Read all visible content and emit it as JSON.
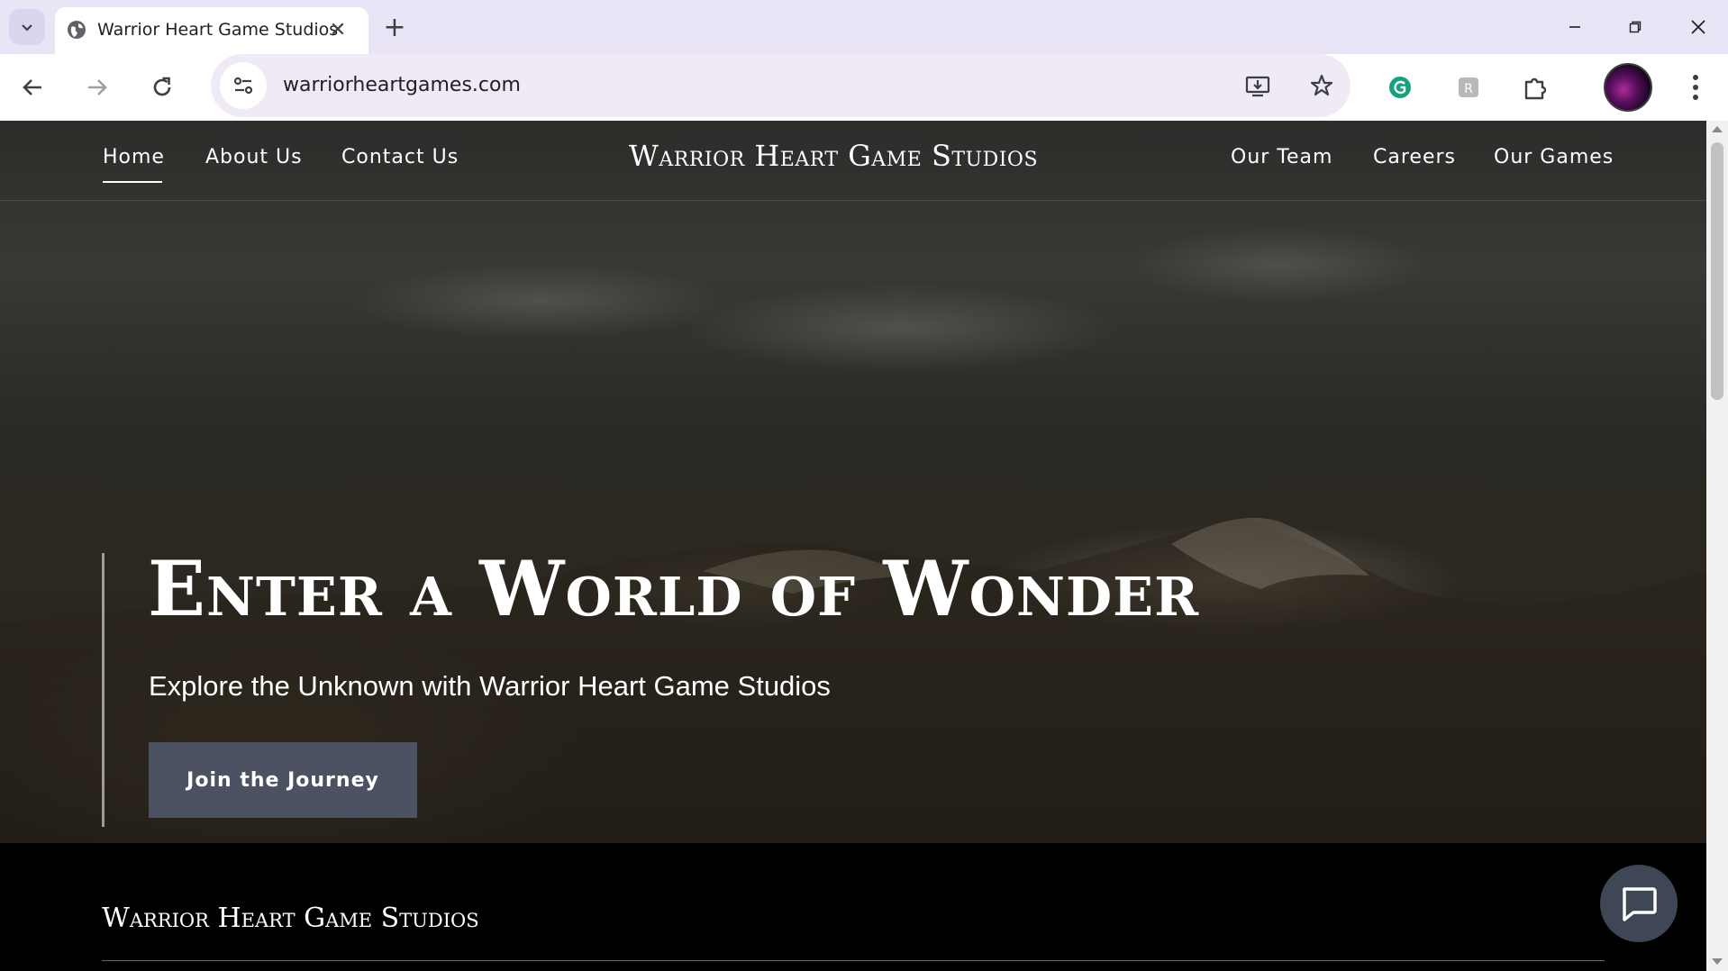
{
  "browser": {
    "tab": {
      "title": "Warrior Heart Game Studios",
      "favicon": "globe-icon",
      "close_glyph": "✕"
    },
    "new_tab_glyph": "+",
    "address_bar": {
      "url": "warriorheartgames.com",
      "site_info_icon": "tune-icon"
    },
    "toolbar_icons": [
      "back-icon",
      "forward-icon",
      "reload-icon",
      "install-app-icon",
      "bookmark-star-icon",
      "grammarly-icon",
      "extension-r-icon",
      "extensions-puzzle-icon",
      "profile-avatar",
      "menu-icon"
    ],
    "window_controls": [
      "minimize-icon",
      "restore-icon",
      "close-icon"
    ]
  },
  "site": {
    "nav": {
      "left": [
        "Home",
        "About Us",
        "Contact Us"
      ],
      "active": "Home",
      "brand": "Warrior Heart Game Studios",
      "right": [
        "Our Team",
        "Careers",
        "Our Games"
      ]
    },
    "hero": {
      "title": "Enter a World of Wonder",
      "subtitle": "Explore the Unknown with Warrior Heart Game Studios",
      "cta": "Join the Journey"
    },
    "footer": {
      "brand": "Warrior Heart Game Studios"
    },
    "chat_widget_icon": "chat-bubble-icon"
  },
  "colors": {
    "tab_strip": "#e9e4f6",
    "omnibox": "#efeaf5",
    "cta_button": "#4c5262",
    "chat_widget": "#3f4656"
  }
}
